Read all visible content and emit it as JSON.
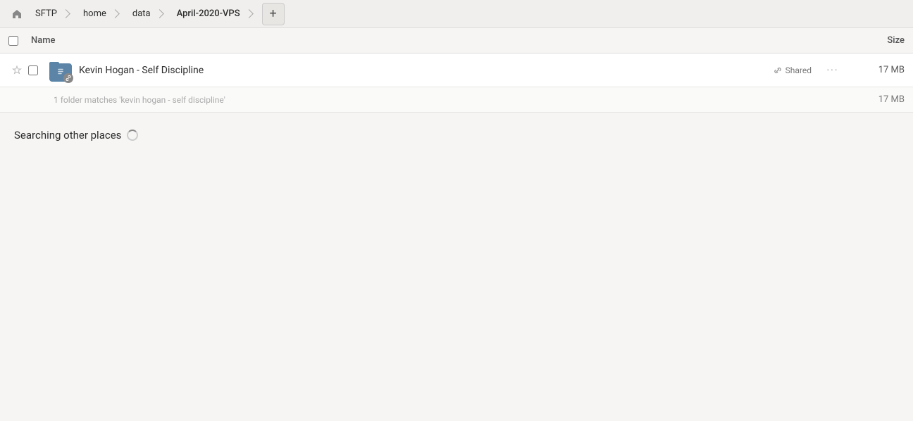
{
  "breadcrumb": {
    "home_icon": "⌂",
    "items": [
      {
        "label": "SFTP",
        "active": false
      },
      {
        "label": "home",
        "active": false
      },
      {
        "label": "data",
        "active": false
      },
      {
        "label": "April-2020-VPS",
        "active": true
      }
    ],
    "add_tab_label": "+"
  },
  "columns": {
    "name_label": "Name",
    "size_label": "Size"
  },
  "file_row": {
    "name": "Kevin Hogan - Self Discipline",
    "shared_label": "Shared",
    "size": "17 MB",
    "more_icon": "···"
  },
  "search_result": {
    "text": "1 folder matches 'kevin hogan - self discipline'",
    "size": "17 MB"
  },
  "searching_section": {
    "label": "Searching other places"
  }
}
